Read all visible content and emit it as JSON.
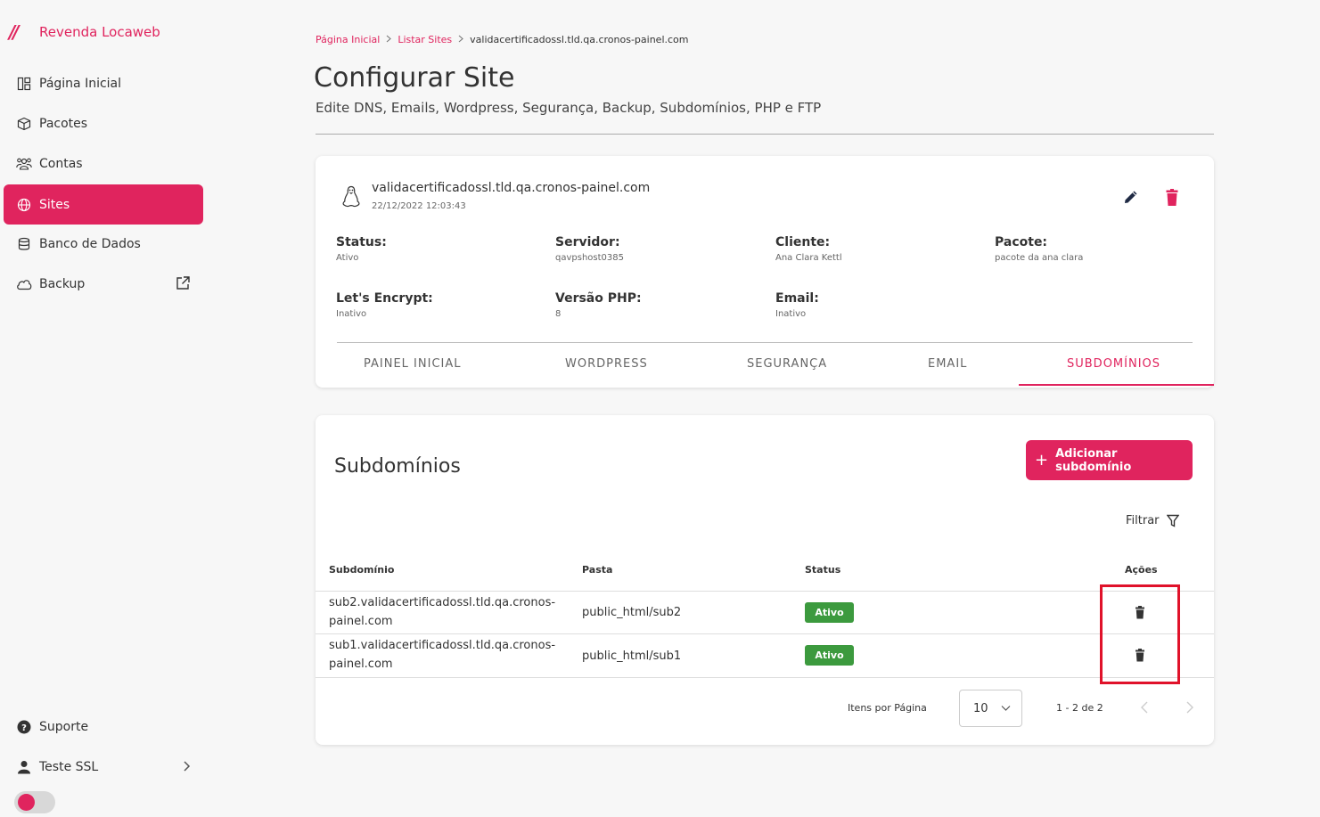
{
  "brand": {
    "logo": "//",
    "name": "Revenda Locaweb"
  },
  "sidebar": {
    "items": [
      {
        "label": "Página Inicial",
        "icon": "dashboard-icon"
      },
      {
        "label": "Pacotes",
        "icon": "box-icon"
      },
      {
        "label": "Contas",
        "icon": "users-icon"
      },
      {
        "label": "Sites",
        "icon": "globe-icon",
        "active": true
      },
      {
        "label": "Banco de Dados",
        "icon": "database-icon"
      },
      {
        "label": "Backup",
        "icon": "cloud-icon"
      }
    ],
    "support": "Suporte",
    "user": "Teste SSL"
  },
  "breadcrumb": {
    "home": "Página Inicial",
    "list": "Listar Sites",
    "current": "validacertificadossl.tld.qa.cronos-painel.com"
  },
  "page": {
    "title": "Configurar Site",
    "subtitle": "Edite DNS, Emails, Wordpress, Segurança, Backup, Subdomínios, PHP e FTP"
  },
  "site": {
    "name": "validacertificadossl.tld.qa.cronos-painel.com",
    "date": "22/12/2022 12:03:43",
    "status_label": "Status:",
    "status": "Ativo",
    "server_label": "Servidor:",
    "server": "qavpshost0385",
    "client_label": "Cliente:",
    "client": "Ana Clara Kettl",
    "package_label": "Pacote:",
    "package": "pacote da ana clara",
    "ssl_label": "Let's Encrypt:",
    "ssl": "Inativo",
    "php_label": "Versão PHP:",
    "php": "8",
    "email_label": "Email:",
    "email": "Inativo"
  },
  "tabs": [
    "PAINEL INICIAL",
    "WORDPRESS",
    "SEGURANÇA",
    "EMAIL",
    "SUBDOMÍNIOS"
  ],
  "subdomains": {
    "title": "Subdomínios",
    "add_label": "Adicionar subdomínio",
    "filter_label": "Filtrar",
    "columns": [
      "Subdomínio",
      "Pasta",
      "Status",
      "Ações"
    ],
    "rows": [
      {
        "line1": "sub2.validacertificadossl.tld.qa.cronos-",
        "line2": "painel.com",
        "folder": "public_html/sub2",
        "status": "Ativo"
      },
      {
        "line1": "sub1.validacertificadossl.tld.qa.cronos-",
        "line2": "painel.com",
        "folder": "public_html/sub1",
        "status": "Ativo"
      }
    ],
    "items_per_page_label": "Itens por Página",
    "items_per_page": "10",
    "range": "1 - 2 de 2"
  },
  "colors": {
    "accent": "#e0245e",
    "success": "#3c9a3e",
    "highlight": "#e0122a"
  }
}
